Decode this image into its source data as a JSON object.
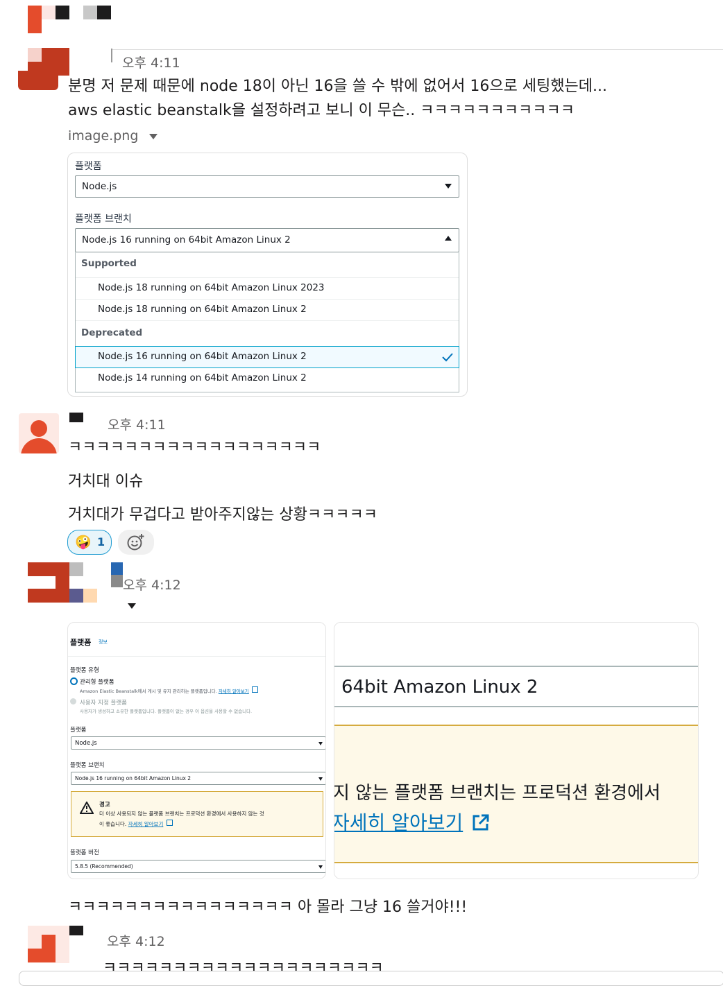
{
  "colors": {
    "accent_red": "#e44c2c",
    "dark_red": "#c0391f",
    "aws_blue": "#0073bb",
    "warn_bg": "#fef9e8",
    "warn_border": "#d5ab3e"
  },
  "messages": [
    {
      "time": "오후 4:11",
      "lines": [
        "분명 저 문제 때문에 node 18이 아닌 16을 쓸 수 밖에 없어서 16으로 세팅했는데...",
        "aws elastic beanstalk을 설정하려고 보니 이 무슨.. ㅋㅋㅋㅋㅋㅋㅋㅋㅋㅋㅋ"
      ],
      "attachment": {
        "file_name": "image.png",
        "platform_label": "플랫폼",
        "platform_value": "Node.js",
        "branch_label": "플랫폼 브랜치",
        "branch_value": "Node.js 16 running on 64bit Amazon Linux 2",
        "groups": [
          {
            "name": "Supported",
            "options": [
              "Node.js 18 running on 64bit Amazon Linux 2023",
              "Node.js 18 running on 64bit Amazon Linux 2"
            ]
          },
          {
            "name": "Deprecated",
            "options": [
              "Node.js 16 running on 64bit Amazon Linux 2",
              "Node.js 14 running on 64bit Amazon Linux 2"
            ]
          }
        ],
        "selected_option": "Node.js 16 running on 64bit Amazon Linux 2"
      }
    },
    {
      "time": "오후 4:11",
      "lines": [
        "ㅋㅋㅋㅋㅋㅋㅋㅋㅋㅋㅋㅋㅋㅋㅋㅋㅋㅋ",
        "거치대 이슈",
        "거치대가 무겁다고 받아주지않는 상황ㅋㅋㅋㅋㅋ"
      ],
      "reaction": {
        "emoji": "🤪",
        "count": "1"
      },
      "add_reaction_icon": "add-emoji-icon"
    },
    {
      "time": "오후 4:12",
      "screenshot_left": {
        "section_title": "플랫폼",
        "section_info": "정보",
        "type_label": "플랫폼 유형",
        "managed_label": "관리형 플랫폼",
        "managed_desc": "Amazon Elastic Beanstalk에서 게시 및 유지 관리하는 플랫폼입니다.",
        "learn_more": "자세히 알아보기",
        "custom_label": "사용자 지정 플랫폼",
        "custom_desc": "사용자가 생성하고 소유한 플랫폼입니다. 플랫폼이 없는 경우 이 옵션을 사용할 수 없습니다.",
        "platform_label": "플랫폼",
        "platform_value": "Node.js",
        "branch_label": "플랫폼 브랜치",
        "branch_value": "Node.js 16 running on 64bit Amazon Linux 2",
        "warning_title": "경고",
        "warning_text_1": "더 이상 사용되지 않는 플랫폼 브랜치는 프로덕션 환경에서 사용하지 않는 것",
        "warning_text_2": "이 좋습니다.",
        "warning_link": "자세히 알아보기",
        "version_label": "플랫폼 버전",
        "version_value": "5.8.5 (Recommended)"
      },
      "screenshot_right": {
        "branch_fragment": "64bit Amazon Linux 2",
        "warning_fragment": "지 않는 플랫폼 브랜치는 프로덕션 환경에서",
        "link_fragment": "자세히 알아보기"
      },
      "text": "ㅋㅋㅋㅋㅋㅋㅋㅋㅋㅋㅋㅋㅋㅋㅋㅋ 아 몰라 그냥 16 쓸거야!!!"
    },
    {
      "time": "오후 4:12",
      "text": "ㅋㅋㅋㅋㅋㅋㅋㅋㅋㅋㅋㅋㅋㅋㅋㅋㅋㅋㅋㅋ"
    }
  ]
}
